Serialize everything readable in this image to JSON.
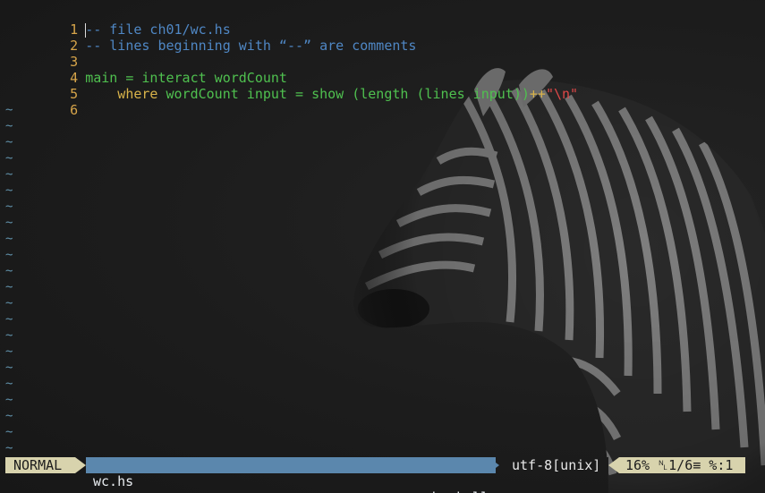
{
  "editor": {
    "lines": [
      {
        "num": "1",
        "text": "-- file ch01/wc.hs"
      },
      {
        "num": "2",
        "text": "-- lines beginning with “--” are comments"
      },
      {
        "num": "3",
        "text": ""
      },
      {
        "num": "4",
        "tokens": [
          "main",
          " = ",
          "interact wordCount"
        ]
      },
      {
        "num": "5",
        "tokens": [
          "    where ",
          "wordCount input",
          " = ",
          "show (length (lines input))",
          "++",
          "\"\\n\""
        ]
      },
      {
        "num": "6",
        "text": ""
      }
    ],
    "tilde": "~"
  },
  "statusline": {
    "mode": "NORMAL",
    "filename": "wc.hs",
    "filetype": "haskell",
    "encoding": "utf-8[unix]",
    "percent": "16%",
    "line_symbol": "␤",
    "position": "1/6",
    "col_symbol": "≡",
    "column": "%:1"
  },
  "colors": {
    "comment": "#4f87c4",
    "keyword": "#4fc04f",
    "operator": "#d8b34a",
    "string": "#e04848",
    "mode_bg": "#d8d3ad",
    "file_bg": "#5b87ad"
  },
  "background_icon": "zebra-photo"
}
